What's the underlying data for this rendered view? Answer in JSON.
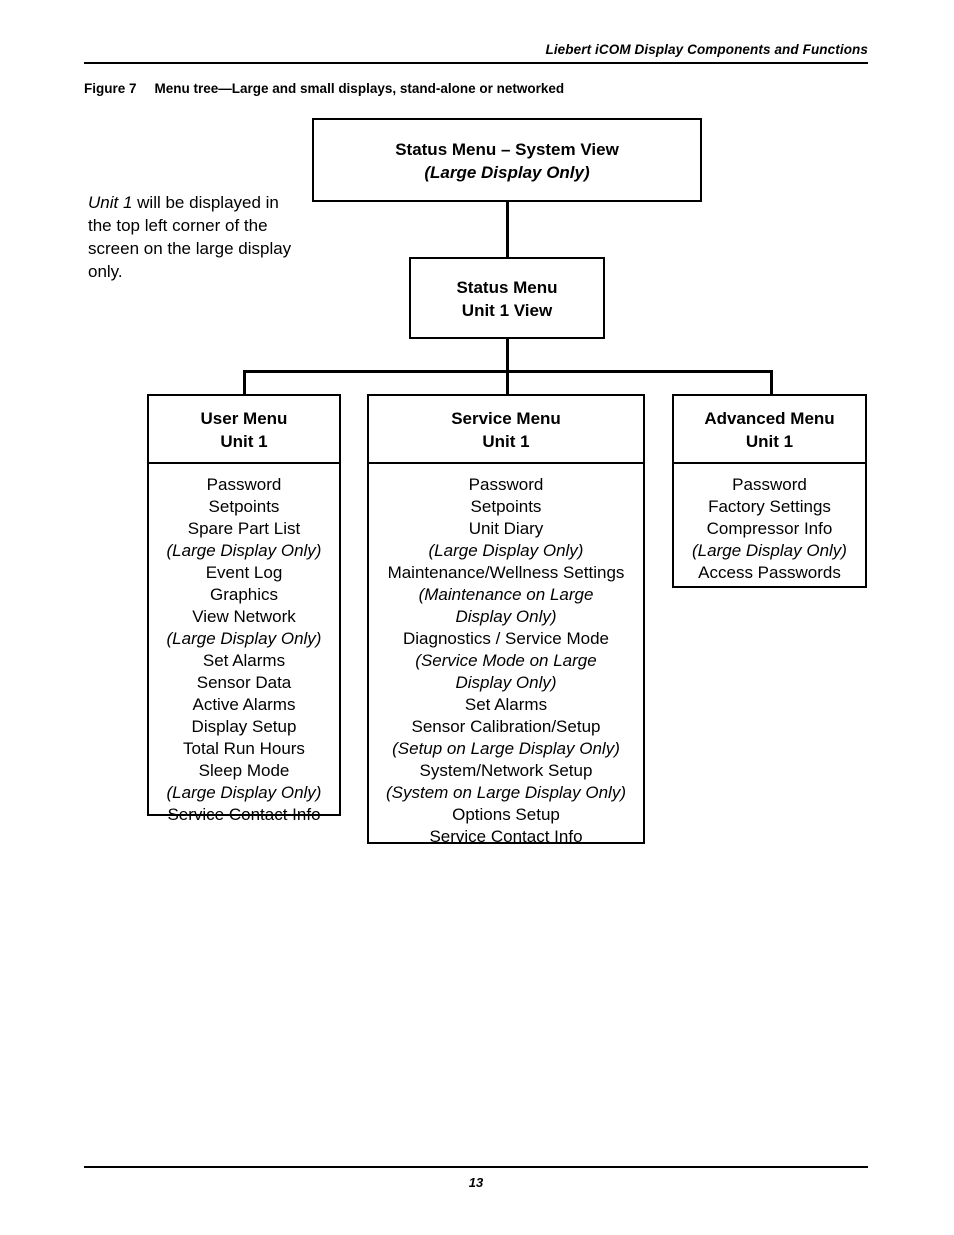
{
  "page": {
    "header": "Liebert iCOM Display Components and Functions",
    "figure_label": "Figure 7",
    "figure_title": "Menu tree—Large and small displays, stand-alone or networked",
    "page_number": "13"
  },
  "side_note": {
    "emphasis": "Unit 1",
    "rest": " will be displayed in the top left corner of the screen on the large display only."
  },
  "nodes": {
    "status_system": {
      "line1": "Status Menu – System View",
      "line2": "(Large Display Only)"
    },
    "status_unit": {
      "line1": "Status Menu",
      "line2": "Unit 1 View"
    },
    "user_menu": {
      "line1": "User Menu",
      "line2": "Unit 1",
      "items": [
        {
          "text": "Password",
          "italic": false
        },
        {
          "text": "Setpoints",
          "italic": false
        },
        {
          "text": "Spare Part List",
          "italic": false
        },
        {
          "text": "(Large Display Only)",
          "italic": true
        },
        {
          "text": "Event Log",
          "italic": false
        },
        {
          "text": "Graphics",
          "italic": false
        },
        {
          "text": "View Network",
          "italic": false
        },
        {
          "text": "(Large Display Only)",
          "italic": true
        },
        {
          "text": "Set Alarms",
          "italic": false
        },
        {
          "text": "Sensor Data",
          "italic": false
        },
        {
          "text": "Active Alarms",
          "italic": false
        },
        {
          "text": "Display Setup",
          "italic": false
        },
        {
          "text": "Total Run Hours",
          "italic": false
        },
        {
          "text": "Sleep Mode",
          "italic": false
        },
        {
          "text": "(Large Display Only)",
          "italic": true
        },
        {
          "text": "Service Contact Info",
          "italic": false
        }
      ]
    },
    "service_menu": {
      "line1": "Service Menu",
      "line2": "Unit 1",
      "items": [
        {
          "text": "Password",
          "italic": false
        },
        {
          "text": "Setpoints",
          "italic": false
        },
        {
          "text": "Unit Diary",
          "italic": false
        },
        {
          "text": "(Large Display Only)",
          "italic": true
        },
        {
          "text": "Maintenance/Wellness Settings",
          "italic": false
        },
        {
          "text": "(Maintenance on Large",
          "italic": true
        },
        {
          "text": "Display Only)",
          "italic": true
        },
        {
          "text": "Diagnostics / Service Mode",
          "italic": false
        },
        {
          "text": "(Service Mode on Large",
          "italic": true
        },
        {
          "text": "Display Only)",
          "italic": true
        },
        {
          "text": "Set Alarms",
          "italic": false
        },
        {
          "text": "Sensor Calibration/Setup",
          "italic": false
        },
        {
          "text": "(Setup on Large Display Only)",
          "italic": true
        },
        {
          "text": "System/Network Setup",
          "italic": false
        },
        {
          "text": "(System on Large Display Only)",
          "italic": true
        },
        {
          "text": "Options Setup",
          "italic": false
        },
        {
          "text": "Service Contact Info",
          "italic": false
        }
      ]
    },
    "advanced_menu": {
      "line1": "Advanced Menu",
      "line2": "Unit 1",
      "items": [
        {
          "text": "Password",
          "italic": false
        },
        {
          "text": "Factory Settings",
          "italic": false
        },
        {
          "text": "Compressor Info",
          "italic": false
        },
        {
          "text": "(Large Display Only)",
          "italic": true
        },
        {
          "text": "Access Passwords",
          "italic": false
        }
      ]
    }
  },
  "colors": {
    "ink": "#000000",
    "paper": "#ffffff"
  }
}
